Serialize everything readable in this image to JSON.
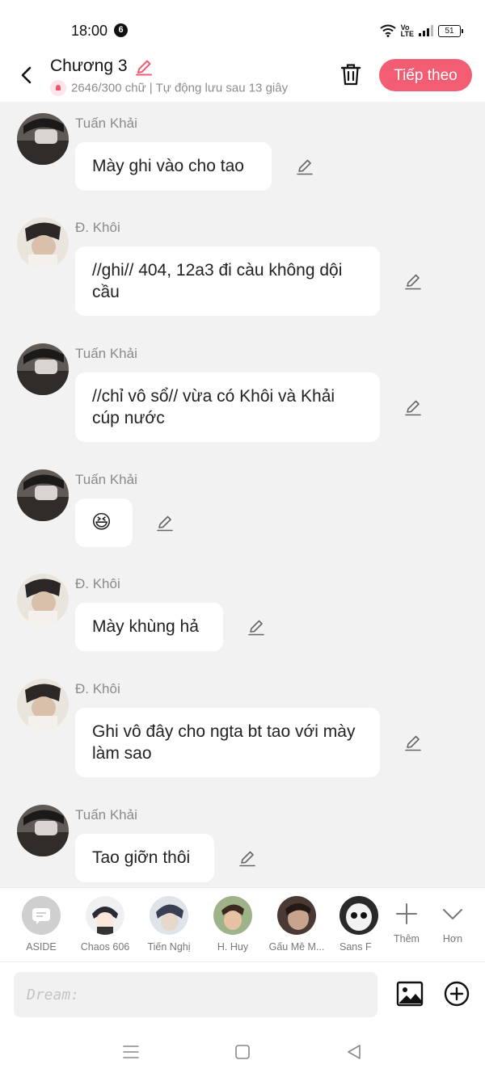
{
  "status_bar": {
    "time": "18:00",
    "notification_count": "6",
    "network_label": "Vo LTE",
    "battery": "51"
  },
  "header": {
    "title": "Chương 3",
    "subtitle": "2646/300 chữ | Tự động lưu sau 13 giây",
    "next_label": "Tiếp theo"
  },
  "messages": [
    {
      "sender": "Tuấn Khải",
      "text": "Mày ghi vào cho tao"
    },
    {
      "sender": "Đ. Khôi",
      "text": "//ghi// 404, 12a3 đi càu không dội cầu"
    },
    {
      "sender": "Tuấn Khải",
      "text": "//chỉ vô sổ// vừa có Khôi và Khải cúp nước"
    },
    {
      "sender": "Tuấn Khải",
      "text": "😆"
    },
    {
      "sender": "Đ. Khôi",
      "text": "Mày khùng hả"
    },
    {
      "sender": "Đ. Khôi",
      "text": "Ghi vô đây cho ngta bt tao với mày làm sao"
    },
    {
      "sender": "Tuấn Khải",
      "text": "Tao giỡn thôi"
    }
  ],
  "characters": [
    {
      "name": "ASIDE",
      "icon": "chat-bubble-icon"
    },
    {
      "name": "Chaos 606"
    },
    {
      "name": "Tiến Nghị"
    },
    {
      "name": "H. Huy"
    },
    {
      "name": "Gấu Mê M..."
    },
    {
      "name": "Sans F"
    }
  ],
  "character_actions": {
    "add_label": "Thêm",
    "more_label": "Hơn"
  },
  "composer": {
    "placeholder": "Dream:"
  },
  "colors": {
    "accent": "#f35d73",
    "background": "#f2f2f2",
    "bubble": "#ffffff"
  }
}
